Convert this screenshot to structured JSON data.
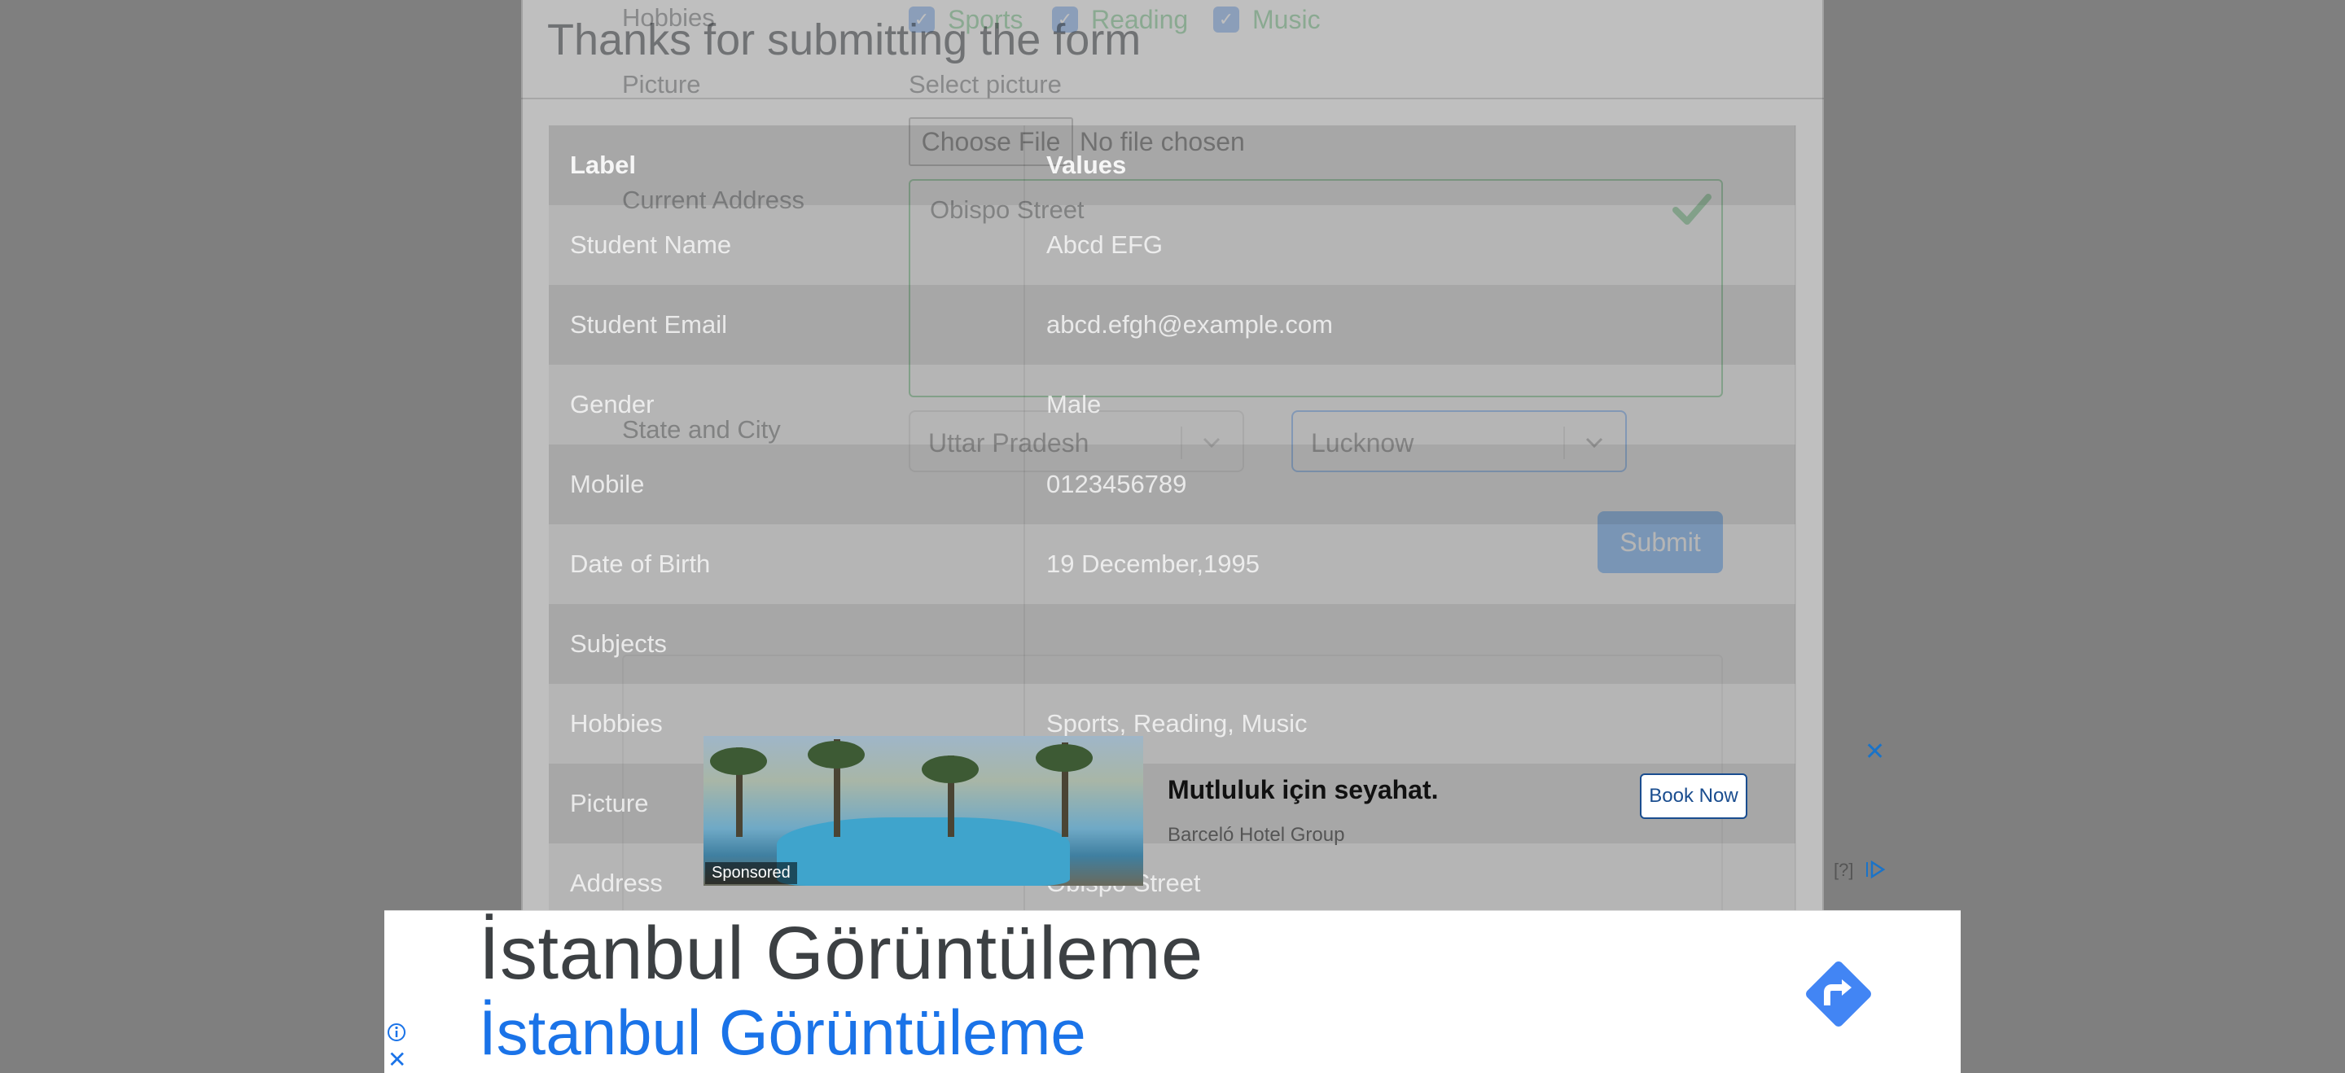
{
  "form": {
    "hobbies_label": "Hobbies",
    "hobbies": [
      "Sports",
      "Reading",
      "Music"
    ],
    "picture_label": "Picture",
    "select_picture_label": "Select picture",
    "file_button": "Choose File",
    "file_status": "No file chosen",
    "address_label": "Current Address",
    "address_value": "Obispo Street",
    "state_city_label": "State and City",
    "state_value": "Uttar Pradesh",
    "city_value": "Lucknow",
    "submit_label": "Submit"
  },
  "modal": {
    "title": "Thanks for submitting the form",
    "headers": [
      "Label",
      "Values"
    ],
    "rows": [
      [
        "Student Name",
        "Abcd EFG"
      ],
      [
        "Student Email",
        "abcd.efgh@example.com"
      ],
      [
        "Gender",
        "Male"
      ],
      [
        "Mobile",
        "0123456789"
      ],
      [
        "Date of Birth",
        "19 December,1995"
      ],
      [
        "Subjects",
        ""
      ],
      [
        "Hobbies",
        "Sports, Reading, Music"
      ],
      [
        "Picture",
        ""
      ],
      [
        "Address",
        "Obispo Street"
      ]
    ]
  },
  "ad": {
    "sponsored": "Sponsored",
    "headline": "Mutluluk için seyahat.",
    "brand": "Barceló Hotel Group",
    "cta": "Book Now",
    "close": "✕",
    "info": "[?]"
  },
  "banner": {
    "line1": "İstanbul Görüntüleme",
    "line2": "İstanbul Görüntüleme",
    "close": "✕"
  },
  "colors": {
    "checkbox": "#2f7ae5",
    "checkbox_label": "#28a745",
    "submit": "#007bff",
    "banner_link": "#1a73e8",
    "directions_icon": "#4285f4"
  }
}
